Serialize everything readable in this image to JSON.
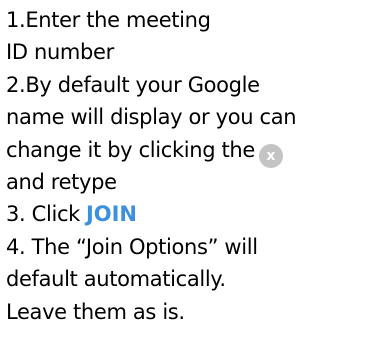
{
  "instructions": {
    "lines": [
      "1.Enter the meeting",
      "ID number",
      "2.By default your Google",
      "name will display or you can",
      "change it by clicking the",
      "and retype",
      "3. Click",
      "4. The “Join Options” will",
      "default automatically.",
      "Leave them as is."
    ],
    "clear_badge_label": "x",
    "join_label": "JOIN"
  },
  "colors": {
    "text": "#000000",
    "join_accent": "#3d8fe0",
    "badge_bg": "#c4c4c4",
    "badge_text": "#ffffff"
  }
}
